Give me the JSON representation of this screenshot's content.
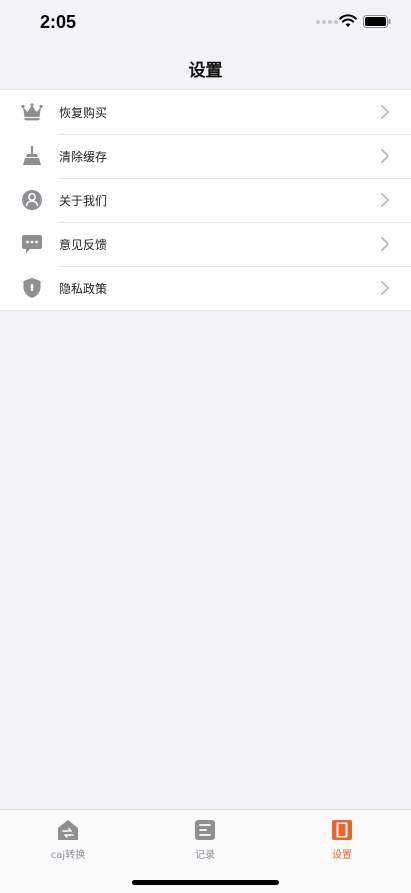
{
  "status_bar": {
    "time": "2:05"
  },
  "nav": {
    "title": "设置"
  },
  "settings": {
    "items": [
      {
        "label": "恢复购买",
        "icon": "crown-icon"
      },
      {
        "label": "清除缓存",
        "icon": "broom-icon"
      },
      {
        "label": "关于我们",
        "icon": "person-icon"
      },
      {
        "label": "意见反馈",
        "icon": "chat-bubble-icon"
      },
      {
        "label": "隐私政策",
        "icon": "shield-icon"
      }
    ]
  },
  "tabs": [
    {
      "label": "caj转换",
      "icon": "home-convert-icon",
      "active": false
    },
    {
      "label": "记录",
      "icon": "record-list-icon",
      "active": false
    },
    {
      "label": "设置",
      "icon": "settings-book-icon",
      "active": true
    }
  ],
  "colors": {
    "accent": "#f0622a",
    "icon_gray": "#8e8e93",
    "background": "#f2f2f7"
  }
}
